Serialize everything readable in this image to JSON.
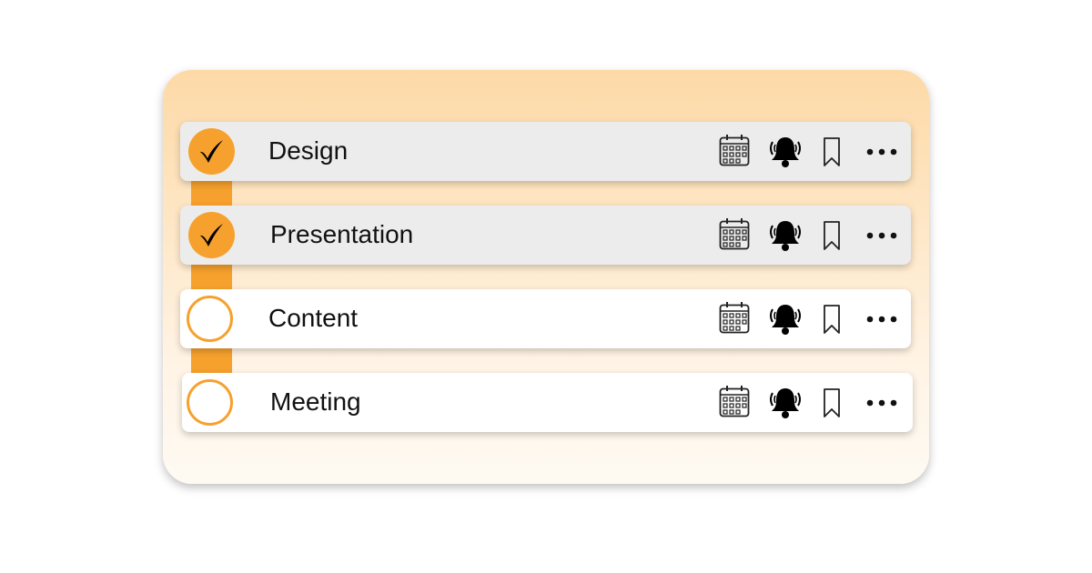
{
  "colors": {
    "accent": "#f6a12d",
    "card_top": "#fdd9a6",
    "card_bottom": "#fefaf3",
    "done_row": "#ececec",
    "todo_row": "#ffffff"
  },
  "tasks": [
    {
      "label": "Design",
      "completed": true
    },
    {
      "label": "Presentation",
      "completed": true
    },
    {
      "label": "Content",
      "completed": false
    },
    {
      "label": "Meeting",
      "completed": false
    }
  ],
  "row_icons": [
    "calendar-icon",
    "alarm-bell-icon",
    "bookmark-icon",
    "more-options-icon"
  ]
}
